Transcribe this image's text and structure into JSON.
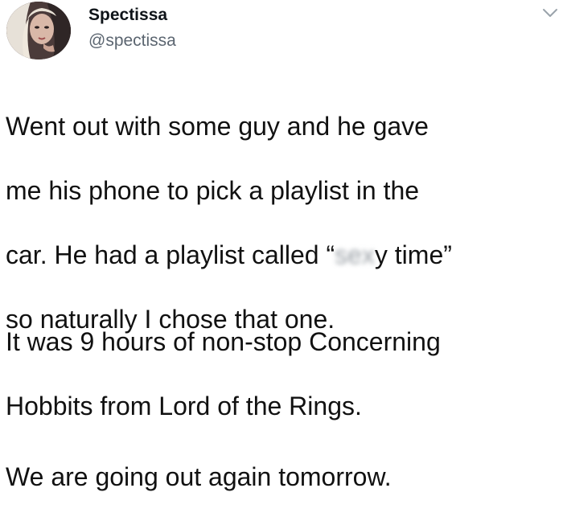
{
  "user": {
    "display_name": "Spectissa",
    "handle": "@spectissa"
  },
  "icons": {
    "avatar": "profile-photo",
    "menu": "chevron-down-icon"
  },
  "tweet": {
    "line1": "Went out with some guy and he gave",
    "line2": "me his phone to pick a playlist in the",
    "line3_pre": "car. He had a playlist called “",
    "line3_blur": "sex",
    "line3_post": "y time”",
    "line4": "so naturally I chose that one.",
    "para2_line1": "It was 9 hours of non-stop Concerning",
    "para2_line2": "Hobbits from Lord of the Rings.",
    "para3": "We are going out again tomorrow."
  },
  "colors": {
    "text": "#111111",
    "handle": "#5b6570",
    "chevron": "#9aa3ab"
  }
}
